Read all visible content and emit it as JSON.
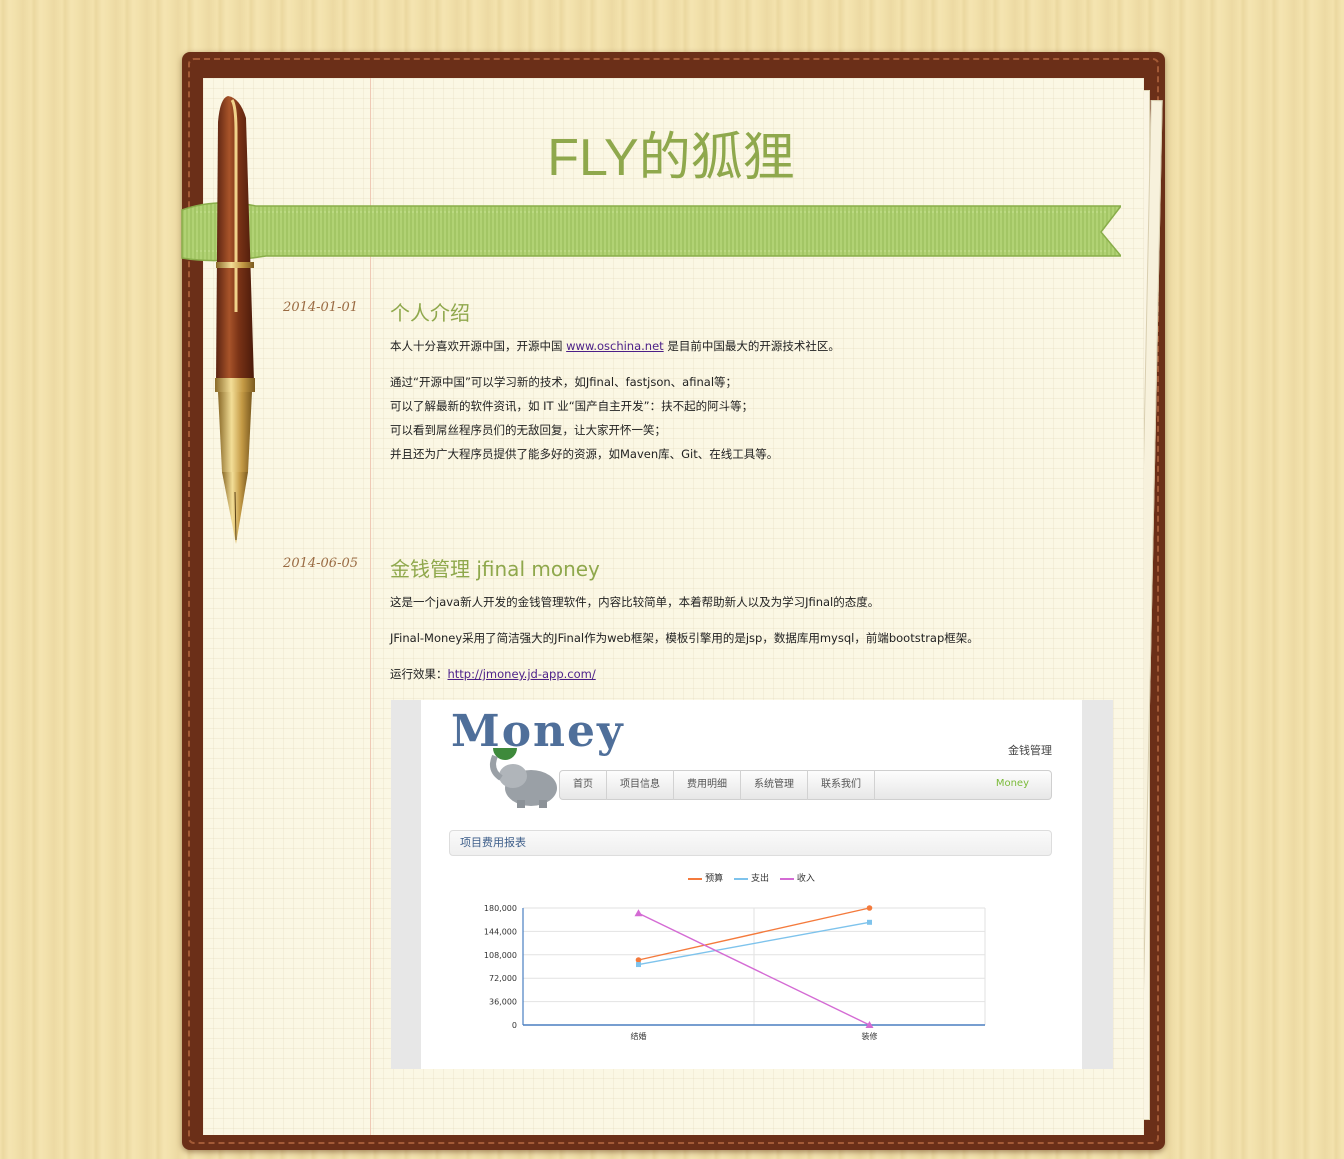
{
  "site": {
    "title": "FLY的狐狸"
  },
  "posts": [
    {
      "date": "2014-01-01",
      "title": "个人介绍",
      "p1_pre": "本人十分喜欢开源中国，开源中国 ",
      "p1_link": "www.oschina.net",
      "p1_post": " 是目前中国最大的开源技术社区。",
      "lines": [
        "通过“开源中国”可以学习新的技术，如Jfinal、fastjson、afinal等；",
        "可以了解最新的软件资讯，如 IT 业“国产自主开发”：扶不起的阿斗等；",
        "可以看到屌丝程序员们的无敌回复，让大家开怀一笑；",
        "并且还为广大程序员提供了能多好的资源，如Maven库、Git、在线工具等。"
      ]
    },
    {
      "date": "2014-06-05",
      "title": "金钱管理 jfinal money",
      "p1": "这是一个java新人开发的金钱管理软件，内容比较简单，本着帮助新人以及为学习Jfinal的态度。",
      "p2": "JFinal-Money采用了简洁强大的JFinal作为web框架，模板引擎用的是jsp，数据库用mysql，前端bootstrap框架。",
      "p3_pre": "运行效果：",
      "p3_link": "http://jmoney.jd-app.com/"
    }
  ],
  "screenshot": {
    "logo": "Money",
    "brand": "金钱管理",
    "nav": [
      "首页",
      "项目信息",
      "费用明细",
      "系统管理",
      "联系我们"
    ],
    "nav_logo": "Money",
    "panel_title": "项目费用报表",
    "legend": [
      "预算",
      "支出",
      "收入"
    ]
  },
  "chart_data": {
    "type": "line",
    "categories": [
      "结婚",
      "装修"
    ],
    "series": [
      {
        "name": "预算",
        "values": [
          100000,
          180000
        ],
        "color": "#f47a3c",
        "marker": "circle"
      },
      {
        "name": "支出",
        "values": [
          93000,
          158000
        ],
        "color": "#7ec3ec",
        "marker": "square"
      },
      {
        "name": "收入",
        "values": [
          172000,
          0
        ],
        "color": "#d46bd4",
        "marker": "triangle"
      }
    ],
    "yticks": [
      "0",
      "36,000",
      "72,000",
      "108,000",
      "144,000",
      "180,000"
    ],
    "ylim": [
      0,
      180000
    ]
  }
}
